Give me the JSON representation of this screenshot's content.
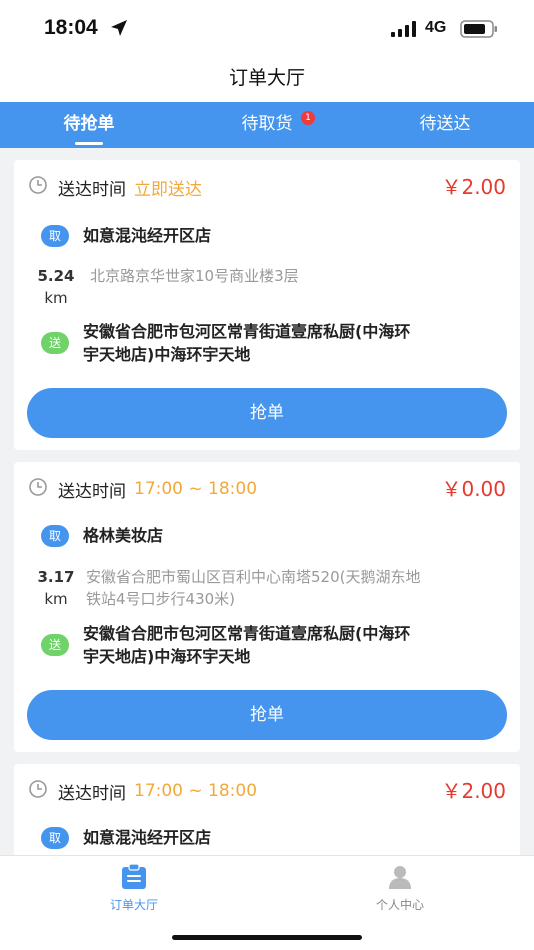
{
  "status_bar": {
    "time": "18:04",
    "network": "4G"
  },
  "nav": {
    "title": "订单大厅"
  },
  "tabs": [
    {
      "label": "待抢单",
      "active": true
    },
    {
      "label": "待取货",
      "badge": "1"
    },
    {
      "label": "待送达"
    }
  ],
  "orders": [
    {
      "time_label": "送达时间",
      "time_value": "立即送达",
      "price": "￥2.00",
      "pick_tag": "取",
      "shop_name": "如意混沌经开区店",
      "distance_num": "5.24",
      "distance_unit": "km",
      "pickup_address": "北京路京华世家10号商业楼3层",
      "send_tag": "送",
      "dest_line1": "安徽省合肥市包河区常青街道壹席私厨(中海环",
      "dest_line2": "宇天地店)中海环宇天地",
      "button_label": "抢单"
    },
    {
      "time_label": "送达时间",
      "time_value": "17:00 ~ 18:00",
      "price": "￥0.00",
      "pick_tag": "取",
      "shop_name": "格林美妆店",
      "distance_num": "3.17",
      "distance_unit": "km",
      "pickup_line1": "安徽省合肥市蜀山区百利中心南塔520(天鹅湖东地",
      "pickup_line2": "铁站4号口步行430米)",
      "send_tag": "送",
      "dest_line1": "安徽省合肥市包河区常青街道壹席私厨(中海环",
      "dest_line2": "宇天地店)中海环宇天地",
      "button_label": "抢单"
    },
    {
      "time_label": "送达时间",
      "time_value": "17:00 ~ 18:00",
      "price": "￥2.00",
      "pick_tag": "取",
      "shop_name": "如意混沌经开区店"
    }
  ],
  "bottom_nav": [
    {
      "label": "订单大厅",
      "icon": "order-list-icon",
      "active": true
    },
    {
      "label": "个人中心",
      "icon": "user-icon"
    }
  ],
  "colors": {
    "primary": "#4595ee",
    "price": "#e53a2f",
    "time_value": "#f2a93b",
    "send_tag": "#6fd36a"
  }
}
